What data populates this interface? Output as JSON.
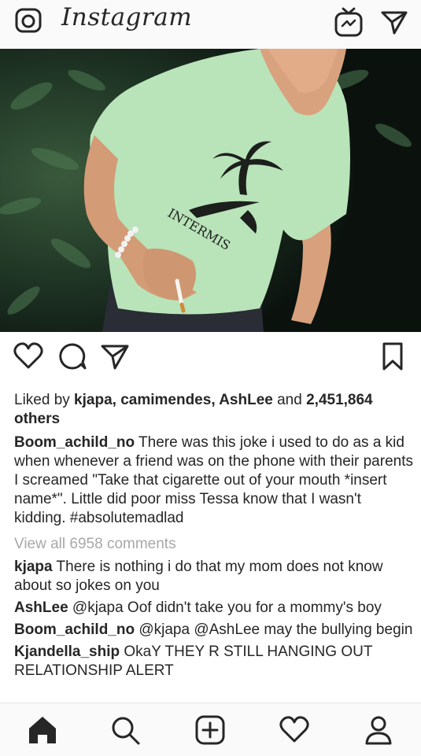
{
  "header": {
    "brand": "Instagram",
    "icons": [
      "camera-icon",
      "igtv-icon",
      "direct-message-icon"
    ]
  },
  "post": {
    "likes": {
      "prefix": "Liked by ",
      "users": [
        "kjapa",
        "camimendes",
        "AshLee"
      ],
      "sep1": ", ",
      "sep2": ", ",
      "and": " and ",
      "count": "2,451,864",
      "suffix": "others"
    },
    "caption": {
      "user": "Boom_achild_no",
      "text": "There was this joke i used to do as a kid when whenever a friend was on the phone with their parents I screamed \"Take that cigarette out of your mouth *insert name*\". Little did poor miss Tessa know that I wasn't kidding. #absolutemadlad"
    },
    "view_all": "View all 6958 comments",
    "comments": [
      {
        "user": "kjapa",
        "text": "There is nothing i do that my mom does not know about so jokes on you"
      },
      {
        "user": "AshLee",
        "text": "@kjapa Oof didn't take you for a mommy's boy"
      },
      {
        "user": "Boom_achild_no",
        "text": "@kjapa @AshLee may the bullying begin"
      },
      {
        "user": "Kjandella_ship",
        "text": "OkaY THEY R STILL HANGING OUT RELATIONSHIP ALERT"
      }
    ],
    "shirt_text": "INTERMIS"
  },
  "tabbar": {
    "items": [
      "home-icon",
      "search-icon",
      "new-post-icon",
      "activity-heart-icon",
      "profile-icon"
    ]
  },
  "colors": {
    "text": "#262626",
    "muted": "#a8a8a8",
    "shirt": "#b9e3b9"
  }
}
